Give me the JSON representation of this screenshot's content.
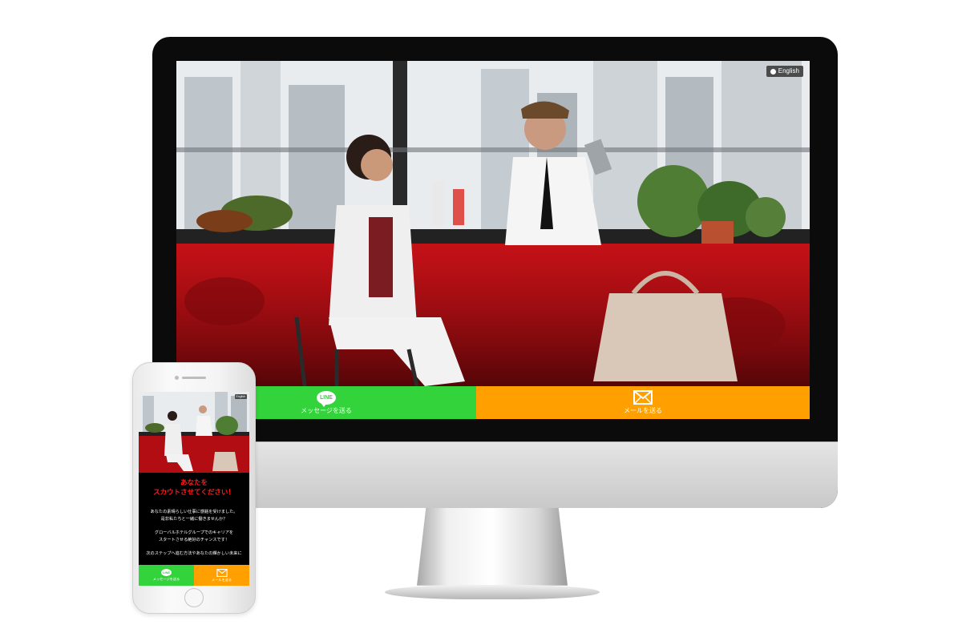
{
  "desktop": {
    "language_button": "English",
    "cta_line_label": "メッセージを送る",
    "cta_line_icon_text": "LINE",
    "cta_mail_label": "メールを送る"
  },
  "mobile": {
    "language_button": "English",
    "headline_line1": "あなたを",
    "headline_line2": "スカウトさせてください！",
    "paragraph1_line1": "あなたの素晴らしい仕事に感銘を受けました。",
    "paragraph1_line2": "是非私たちと一緒に働きませんか？",
    "paragraph2_line1": "グローバルホテルグループでのキャリアを",
    "paragraph2_line2": "スタートさせる絶好のチャンスです！",
    "paragraph3_line1": "次のステップへ進む方法やあなたの輝かしい未来に",
    "cta_line_label": "メッセージを送る",
    "cta_line_icon_text": "LINE",
    "cta_mail_label": "メールを送る"
  },
  "colors": {
    "line_green": "#33d33b",
    "mail_orange": "#ffa000",
    "headline_red": "#ff1a1a",
    "bar_red": "#b10d12"
  }
}
